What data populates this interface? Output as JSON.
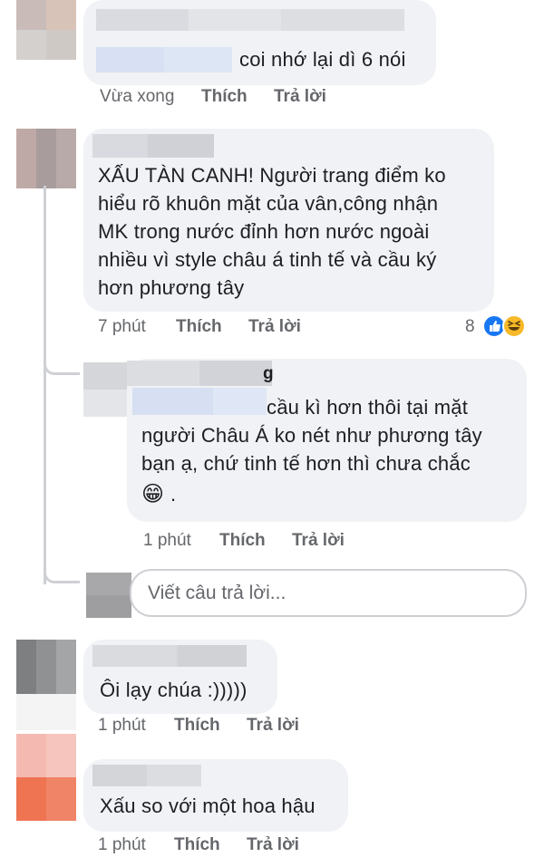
{
  "comments": [
    {
      "text": "coi nhớ lại dì 6 nói",
      "time": "Vừa xong",
      "like": "Thích",
      "reply": "Trả lời"
    },
    {
      "text": "XẤU TÀN CANH! Người trang điểm ko\nhiểu rõ khuôn mặt của vân,công nhận\nMK trong nước đỉnh hơn nước ngoài\nnhiều vì style châu á tinh tế và cầu ký\nhơn phương tây",
      "time": "7 phút",
      "like": "Thích",
      "reply": "Trả lời",
      "reaction_count": "8",
      "reaction_icons": [
        "like-icon",
        "haha-icon"
      ]
    },
    {
      "name_suffix": "g",
      "text_line1": "cầu kì hơn thôi tại mặt",
      "text_rest": "người Châu Á ko nét như phương tây\nbạn ạ, chứ tinh tế hơn thì chưa chắc",
      "emoji": "😁",
      "emoji_tail": ".",
      "time": "1 phút",
      "like": "Thích",
      "reply": "Trả lời"
    },
    {
      "text": "Ôi lạy chúa :)))))",
      "time": "1 phút",
      "like": "Thích",
      "reply": "Trả lời"
    },
    {
      "text": "Xấu so với một hoa hậu",
      "time": "1 phút",
      "like": "Thích",
      "reply": "Trả lời"
    }
  ],
  "reply_box": {
    "placeholder": "Viết câu trả lời..."
  },
  "colors": {
    "bubble": "#f0f2f5",
    "meta_text": "#65676b",
    "like_blue": "#1877f2",
    "haha_yellow": "#f7b928"
  }
}
